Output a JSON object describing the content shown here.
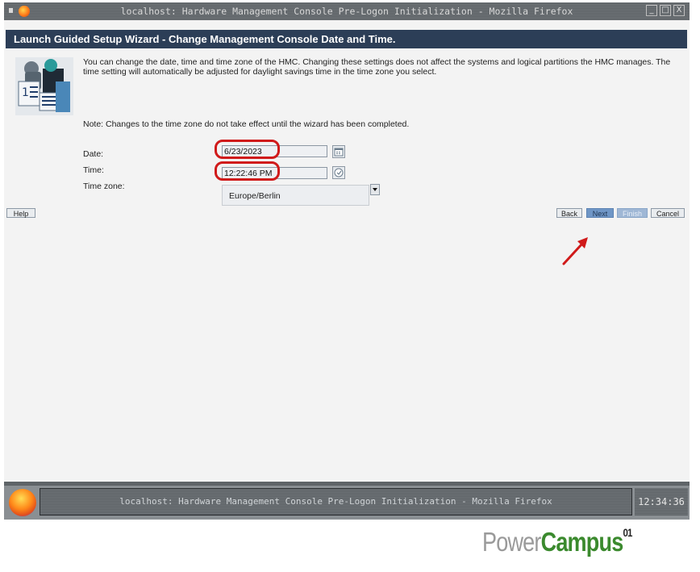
{
  "window": {
    "title": "localhost: Hardware Management Console Pre-Logon Initialization - Mozilla Firefox",
    "controls": [
      "_",
      "□",
      "X"
    ]
  },
  "wizard": {
    "header": "Launch Guided Setup Wizard - Change Management Console Date and Time.",
    "description": "You can change the date, time and time zone of the HMC. Changing these settings does not affect the systems and logical partitions the HMC manages. The time setting will automatically be adjusted for daylight savings time in the time zone you select.",
    "note": "Note: Changes to the time zone do not take effect until the wizard has been completed.",
    "date_label": "Date:",
    "date_value": "6/23/2023",
    "time_label": "Time:",
    "time_value": "12:22:46 PM",
    "timezone_label": "Time zone:",
    "timezone_value": "Europe/Berlin"
  },
  "buttons": {
    "help": "Help",
    "back": "Back",
    "next": "Next",
    "finish": "Finish",
    "cancel": "Cancel"
  },
  "taskbar": {
    "item": "localhost: Hardware Management Console Pre-Logon Initialization - Mozilla Firefox",
    "clock": "12:34:36"
  },
  "logo": {
    "part1": "Power",
    "part2": "Campus",
    "sup": "01"
  },
  "colors": {
    "header_bg": "#2c3e57",
    "annotation_red": "#d01a1a",
    "next_button": "#6f96c6",
    "logo_green": "#3b8a2e"
  }
}
